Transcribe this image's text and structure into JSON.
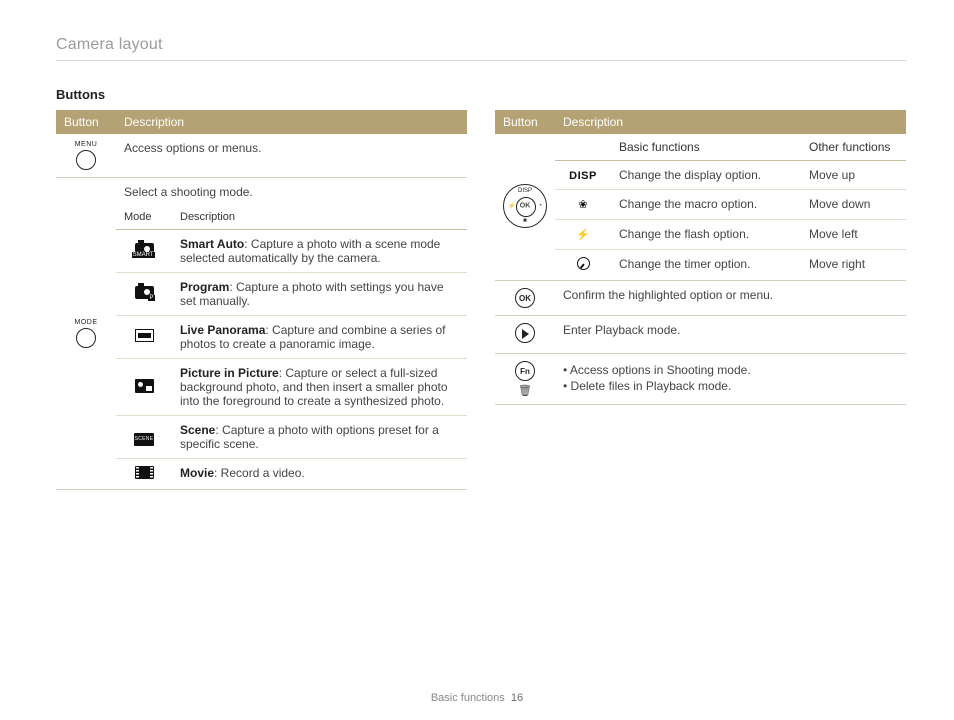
{
  "page_title": "Camera layout",
  "section_title": "Buttons",
  "footer_section": "Basic functions",
  "footer_page": "16",
  "headers": {
    "button": "Button",
    "description": "Description",
    "mode": "Mode",
    "basic": "Basic functions",
    "other": "Other functions"
  },
  "left": {
    "menu_label": "MENU",
    "menu_desc": "Access options or menus.",
    "mode_label": "MODE",
    "mode_intro": "Select a shooting mode.",
    "modes": [
      {
        "name": "Smart Auto",
        "desc": ": Capture a photo with a scene mode selected automatically by the camera.",
        "iconSub": "SMART"
      },
      {
        "name": "Program",
        "desc": ": Capture a photo with settings you have set manually.",
        "iconSub": "P"
      },
      {
        "name": "Live Panorama",
        "desc": ": Capture and combine a series of photos to create a panoramic image."
      },
      {
        "name": "Picture in Picture",
        "desc": ": Capture or select a full-sized background photo, and then insert a smaller photo into the foreground to create a synthesized photo."
      },
      {
        "name": "Scene",
        "desc": ": Capture a photo with options preset for a specific scene."
      },
      {
        "name": "Movie",
        "desc": ": Record a video."
      }
    ]
  },
  "right": {
    "dpad_ok": "OK",
    "dpad": [
      {
        "label": "DISP",
        "basic": "Change the display option.",
        "other": "Move up"
      },
      {
        "label": "macro",
        "basic": "Change the macro option.",
        "other": "Move down"
      },
      {
        "label": "flash",
        "basic": "Change the flash option.",
        "other": "Move left"
      },
      {
        "label": "timer",
        "basic": "Change the timer option.",
        "other": "Move right"
      }
    ],
    "ok_label": "OK",
    "ok_desc": "Confirm the highlighted option or menu.",
    "play_desc": "Enter Playback mode.",
    "fn_label": "Fn",
    "fn_items": [
      "Access options in Shooting mode.",
      "Delete files in Playback mode."
    ]
  }
}
